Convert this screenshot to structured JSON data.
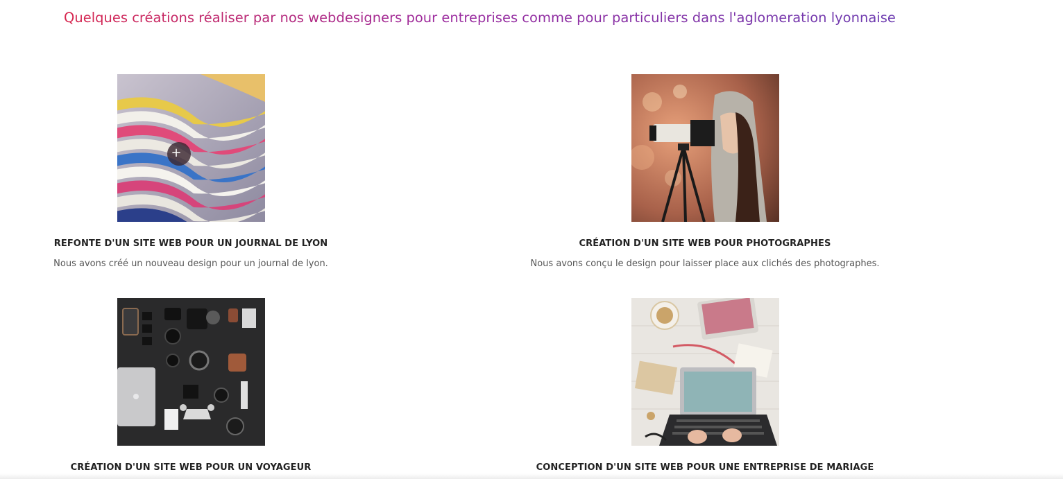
{
  "page": {
    "heading": "Quelques créations réaliser par nos webdesigners pour entreprises comme pour particuliers dans l'aglomeration lyonnaise"
  },
  "portfolio": {
    "items": [
      {
        "title": "REFONTE D'UN SITE WEB POUR UN JOURNAL DE LYON",
        "description": "Nous avons créé un nouveau design pour un journal de lyon.",
        "image_icon": "magazines-image",
        "zoom_label": "+"
      },
      {
        "title": "CRÉATION D'UN SITE WEB POUR PHOTOGRAPHES",
        "description": "Nous avons conçu le design pour laisser place aux clichés des photographes.",
        "image_icon": "photographer-image"
      },
      {
        "title": "CRÉATION D'UN SITE WEB POUR UN VOYAGEUR",
        "description": "",
        "image_icon": "camera-gear-image"
      },
      {
        "title": "CONCEPTION D'UN SITE WEB POUR UNE ENTREPRISE DE MARIAGE",
        "description": "",
        "image_icon": "wedding-desk-image"
      }
    ]
  },
  "colors": {
    "heading_gradient_start": "#d7264e",
    "heading_gradient_end": "#6c3bb0",
    "title_text": "#222222",
    "body_text": "#555555"
  }
}
